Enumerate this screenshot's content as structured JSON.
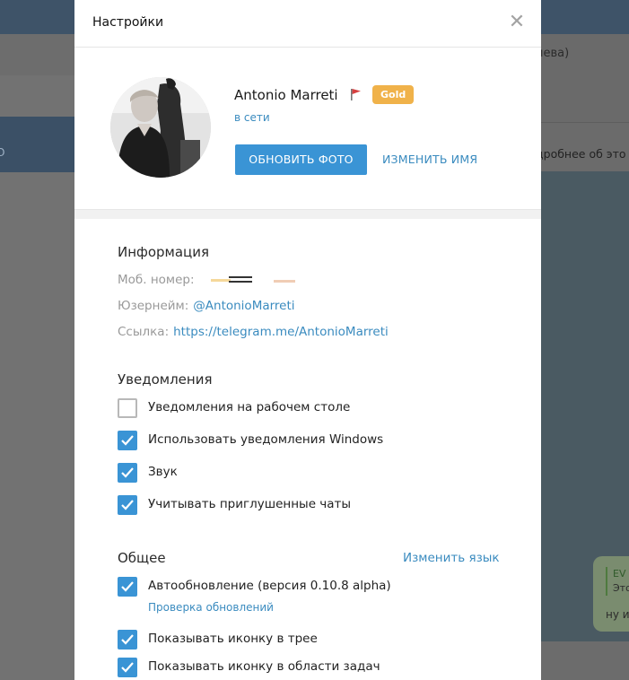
{
  "background": {
    "right_header_text": "иева)",
    "right_info_text": "дробнее об это",
    "left_selected_text": "О",
    "bubble_quote_line1": "EV",
    "bubble_quote_line2": "Это",
    "bubble_text": "ну и"
  },
  "modal": {
    "title": "Настройки",
    "close_icon": "close-icon"
  },
  "profile": {
    "name": "Antonio Marreti",
    "flag_icon": "red-flag-icon",
    "badge": "Gold",
    "badge_color": "#f0b24a",
    "status": "в сети",
    "update_photo_button": "ОБНОВИТЬ ФОТО",
    "edit_name_button": "ИЗМЕНИТЬ ИМЯ"
  },
  "info": {
    "title": "Информация",
    "phone_label": "Моб. номер:",
    "username_label": "Юзернейм:",
    "username_value": "@AntonioMarreti",
    "link_label": "Ссылка:",
    "link_value": "https://telegram.me/AntonioMarreti"
  },
  "notifications": {
    "title": "Уведомления",
    "items": [
      {
        "label": "Уведомления на рабочем столе",
        "checked": false
      },
      {
        "label": "Использовать уведомления Windows",
        "checked": true
      },
      {
        "label": "Звук",
        "checked": true
      },
      {
        "label": "Учитывать приглушенные чаты",
        "checked": true
      }
    ]
  },
  "general": {
    "title": "Общее",
    "change_language": "Изменить язык",
    "items": [
      {
        "label": "Автообновление (версия 0.10.8 alpha)",
        "checked": true
      },
      {
        "label": "Показывать иконку в трее",
        "checked": true
      },
      {
        "label": "Показывать иконку в области задач",
        "checked": true
      }
    ],
    "check_updates_link": "Проверка обновлений"
  },
  "colors": {
    "accent": "#3a94d5",
    "link": "#3a8bbf",
    "header_dark": "#3e5368"
  }
}
